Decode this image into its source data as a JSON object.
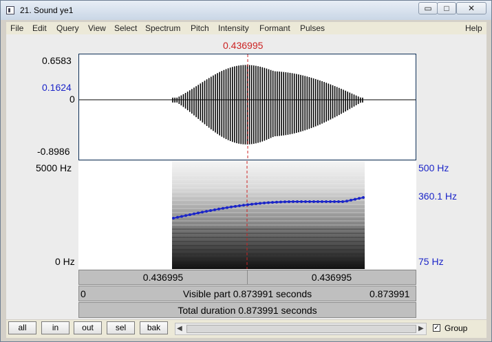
{
  "window": {
    "title": "21. Sound ye1",
    "minimize_label": "▭",
    "restore_label": "□",
    "close_label": "✕"
  },
  "menu": {
    "items": [
      "File",
      "Edit",
      "Query",
      "View",
      "Select",
      "Spectrum",
      "Pitch",
      "Intensity",
      "Formant",
      "Pulses"
    ],
    "help": "Help"
  },
  "cursor": {
    "time": "0.436995"
  },
  "waveform": {
    "max_label": "0.6583",
    "cursor_value": "0.1624",
    "zero_label": "0",
    "min_label": "-0.8986"
  },
  "spectrogram": {
    "top_label": "5000 Hz",
    "bottom_label": "0 Hz",
    "pitch_top": "500 Hz",
    "pitch_value": "360.1 Hz",
    "pitch_bottom": "75 Hz"
  },
  "time_bars": {
    "left_duration": "0.436995",
    "right_duration": "0.436995",
    "visible_label": "Visible part 0.873991 seconds",
    "start": "0",
    "end": "0.873991",
    "total_label": "Total duration 0.873991 seconds"
  },
  "bottom": {
    "buttons": [
      "all",
      "in",
      "out",
      "sel",
      "bak"
    ],
    "group_label": "Group",
    "group_checked": true
  },
  "colors": {
    "accent_red": "#cc2222",
    "pitch_blue": "#1a24c8"
  }
}
